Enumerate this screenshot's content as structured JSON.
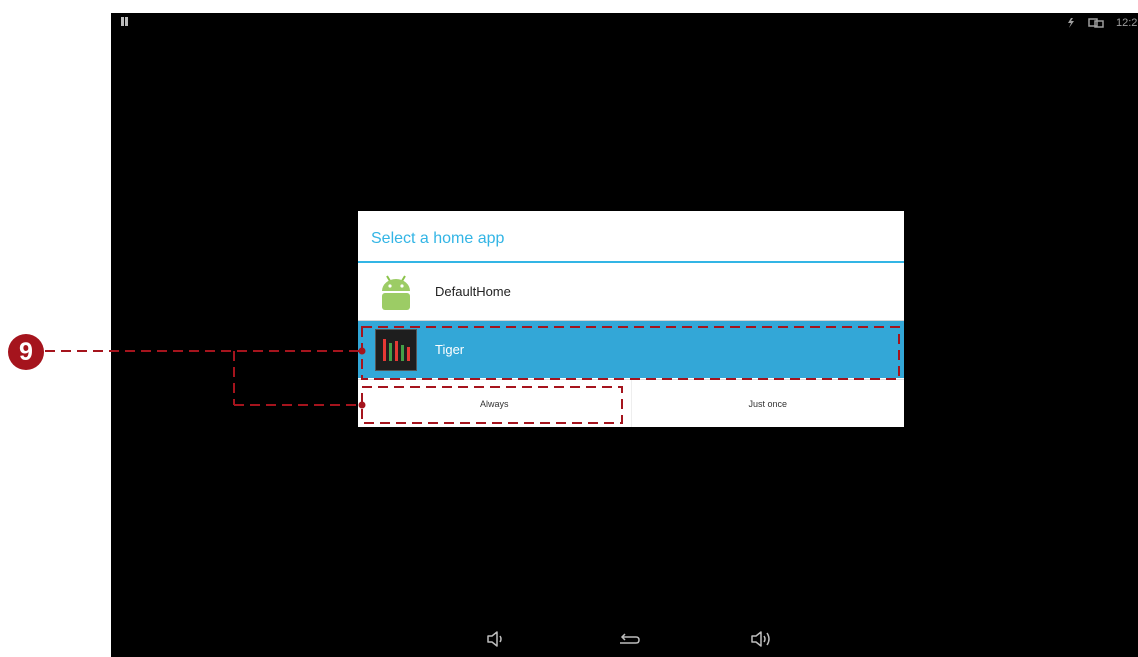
{
  "status_bar": {
    "left_icon": "notification-pause-icon",
    "right_icons": [
      "signal-icon",
      "screen-cast-icon"
    ],
    "clock": "12:2"
  },
  "dialog": {
    "title": "Select a home app",
    "apps": [
      {
        "label": "DefaultHome",
        "icon": "android-icon",
        "selected": false
      },
      {
        "label": "Tiger",
        "icon": "tiger-app-icon",
        "selected": true
      }
    ],
    "buttons": {
      "always": "Always",
      "just_once": "Just once"
    }
  },
  "navigation_bar": {
    "icons": [
      "volume-down-icon",
      "back-icon",
      "volume-up-icon"
    ]
  },
  "annotation": {
    "callout_number": "9",
    "color": "#a5141d"
  },
  "colors": {
    "accent": "#33b5e5",
    "selected_row": "#33a7d7",
    "screen_bg": "#000000"
  }
}
